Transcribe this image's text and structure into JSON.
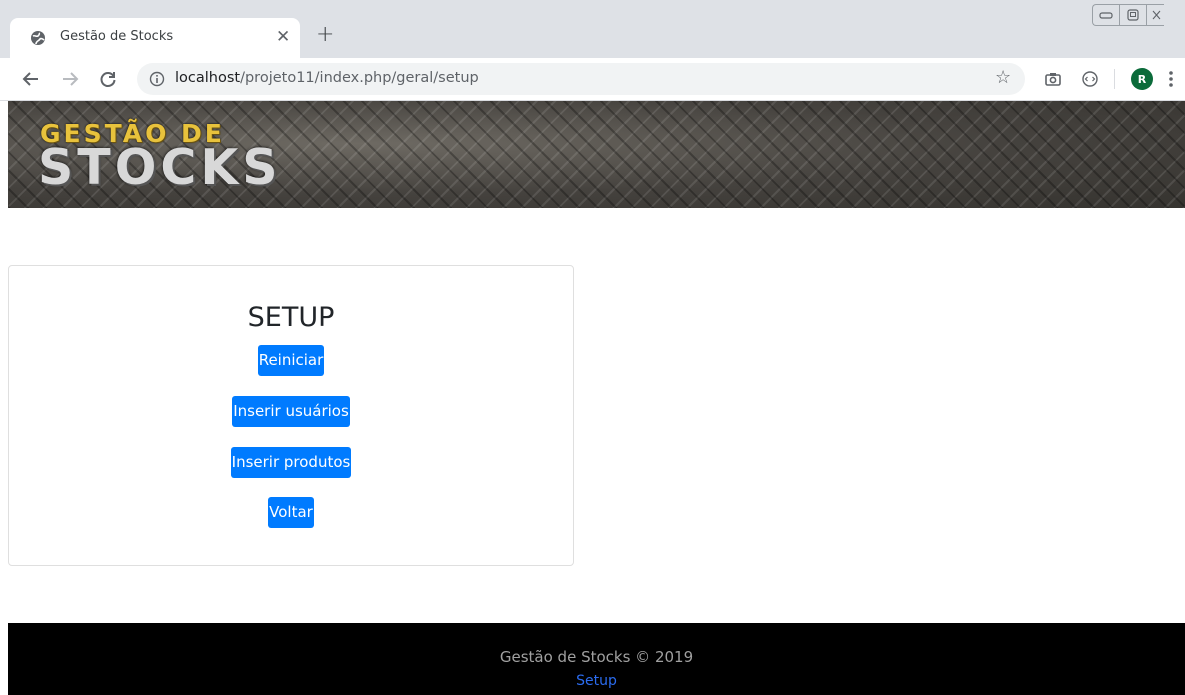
{
  "browser": {
    "tab_title": "Gestão de Stocks",
    "url_host": "localhost",
    "url_path": "/projeto11/index.php/geral/setup",
    "avatar_letter": "R",
    "icons": [
      "globe-icon",
      "close-icon",
      "plus-icon",
      "back-icon",
      "forward-icon",
      "reload-icon",
      "info-icon",
      "star-icon",
      "camera-icon",
      "extension-icon",
      "menu-dots-icon"
    ]
  },
  "banner": {
    "logo_line1": "GESTÃO DE",
    "logo_line2": "STOCKS"
  },
  "setup": {
    "title": "SETUP",
    "buttons": [
      {
        "label": "Reiniciar"
      },
      {
        "label": "Inserir usuários"
      },
      {
        "label": "Inserir produtos"
      },
      {
        "label": "Voltar"
      }
    ]
  },
  "footer": {
    "copyright": "Gestão de Stocks © 2019",
    "link": "Setup"
  },
  "colors": {
    "primary_button": "#007bff",
    "footer_bg": "#000000",
    "footer_link": "#2b6cf0",
    "logo_gold": "#e8c23c"
  }
}
